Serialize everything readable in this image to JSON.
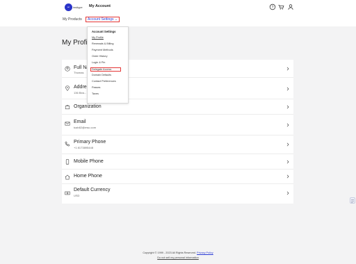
{
  "header": {
    "logo_text": "ac",
    "brand_word": "insitype",
    "page_name": "My Account",
    "icons": [
      "help-icon",
      "cart-icon",
      "user-icon"
    ]
  },
  "subnav": {
    "products": "My Products",
    "settings": "Account Settings",
    "settings_caret": "⌄"
  },
  "dropdown": {
    "heading": "Account Settings",
    "items": [
      "My Profile",
      "Renewals & Billing",
      "Payment Methods",
      "Order History",
      "Login & Pin",
      "Delegate Access",
      "Domain Defaults",
      "Contact Preferences",
      "Passes",
      "Taxes"
    ]
  },
  "profile": {
    "title": "My Profile",
    "rows": [
      {
        "label": "Full Name",
        "value": "Thomas",
        "icon": "user-circle-icon"
      },
      {
        "label": "Address",
        "value": "136 Bea... 11",
        "icon": "location-pin-icon"
      },
      {
        "label": "Organization",
        "value": "",
        "icon": "building-icon"
      },
      {
        "label": "Email",
        "value": "tcah82@msc.com",
        "icon": "mail-icon"
      },
      {
        "label": "Primary Phone",
        "value": "+1 8173895448",
        "icon": "phone-icon"
      },
      {
        "label": "Mobile Phone",
        "value": "",
        "icon": "mobile-icon"
      },
      {
        "label": "Home Phone",
        "value": "",
        "icon": "home-icon"
      },
      {
        "label": "Default Currency",
        "value": "USD",
        "icon": "currency-icon"
      }
    ]
  },
  "footer": {
    "copyright": "Copyright © 1999 - 2023 All Rights Reserved.",
    "privacy": "Privacy Policy",
    "do_not_sell": "Do not sell my personal information"
  },
  "colors": {
    "accent": "#2b3bd6",
    "highlight_border": "#e43434",
    "background": "#f3f3f4"
  }
}
